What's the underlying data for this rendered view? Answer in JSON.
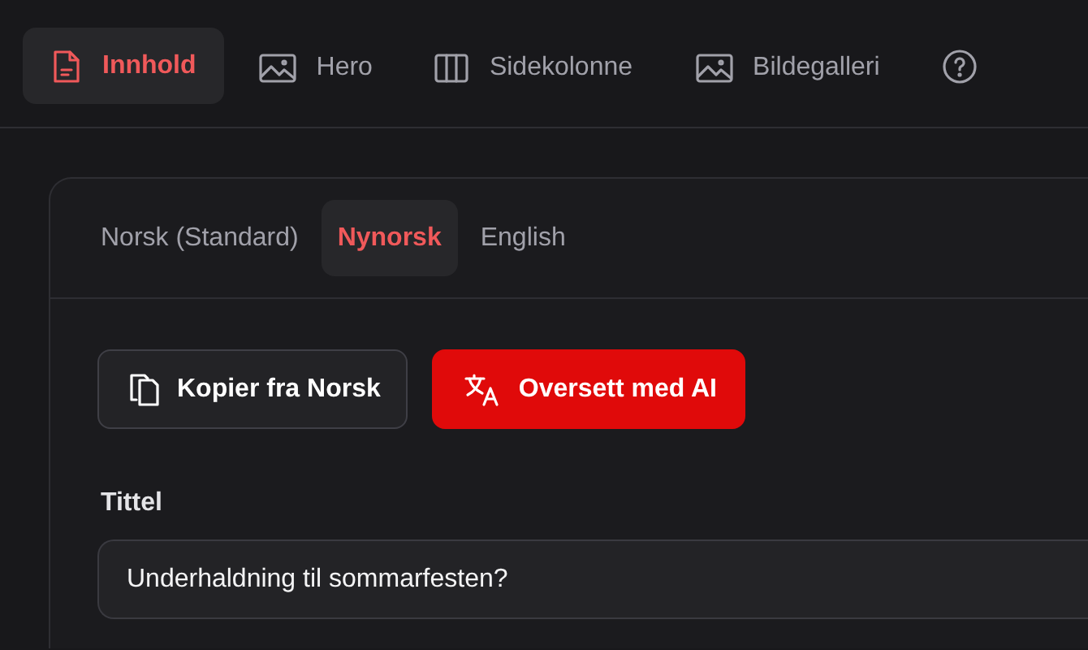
{
  "section_tabs": [
    {
      "label": "Innhold",
      "selected": true
    },
    {
      "label": "Hero",
      "selected": false
    },
    {
      "label": "Sidekolonne",
      "selected": false
    },
    {
      "label": "Bildegalleri",
      "selected": false
    },
    {
      "selected": false
    }
  ],
  "language_tabs": [
    {
      "label": "Norsk (Standard)",
      "selected": false
    },
    {
      "label": "Nynorsk",
      "selected": true
    },
    {
      "label": "English",
      "selected": false
    }
  ],
  "actions": [
    {
      "label": "Kopier fra Norsk",
      "kind": "outline"
    },
    {
      "label": "Oversett med AI",
      "kind": "primary"
    }
  ],
  "title_field": {
    "label": "Tittel",
    "value": "Underhaldning til sommarfesten?"
  }
}
